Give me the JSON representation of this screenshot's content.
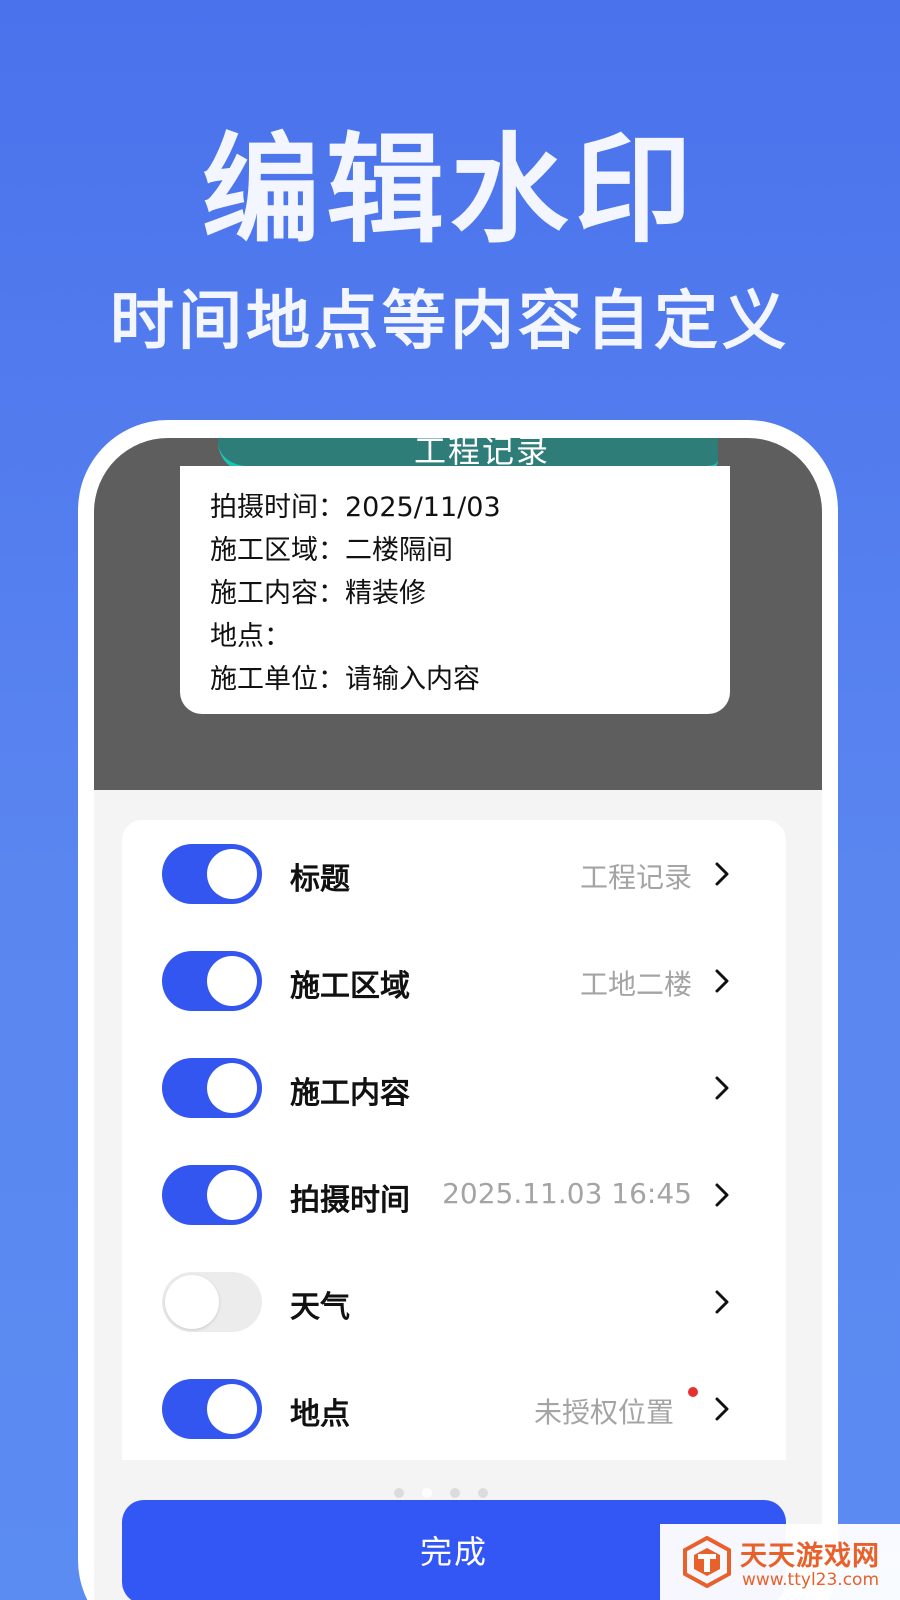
{
  "promo": {
    "title": "编辑水印",
    "subtitle": "时间地点等内容自定义"
  },
  "watermark": {
    "banner_title": "工程记录",
    "lines": [
      {
        "label": "拍摄时间：",
        "value": "2025/11/03"
      },
      {
        "label": "施工区域：",
        "value": "二楼隔间"
      },
      {
        "label": "施工内容：",
        "value": "精装修"
      },
      {
        "label": "地点：",
        "value": ""
      },
      {
        "label": "施工单位：",
        "value": "请输入内容"
      }
    ]
  },
  "settings": {
    "rows": [
      {
        "label": "标题",
        "value": "工程记录",
        "enabled": true,
        "icon": "chevron-right-icon"
      },
      {
        "label": "施工区域",
        "value": "工地二楼",
        "enabled": true,
        "icon": "chevron-right-icon"
      },
      {
        "label": "施工内容",
        "value": "",
        "enabled": true,
        "icon": "chevron-right-icon"
      },
      {
        "label": "拍摄时间",
        "value": "2025.11.03 16:45",
        "enabled": true,
        "icon": "chevron-right-icon"
      },
      {
        "label": "天气",
        "value": "",
        "enabled": false,
        "icon": "chevron-right-icon"
      },
      {
        "label": "地点",
        "value": "未授权位置",
        "enabled": true,
        "has_alert_dot": true,
        "icon": "chevron-right-icon"
      }
    ]
  },
  "pager": {
    "count": 4,
    "active_index": 1
  },
  "done_button": {
    "label": "完成"
  },
  "brand": {
    "name": "天天游戏网",
    "url": "www.ttyl23.com"
  },
  "colors": {
    "background": "#4a72ec",
    "accent": "#3355f0",
    "toggle_off": "#ececec",
    "watermark_banner": "#2f7d78",
    "watermark_banner_edge": "#19c4b0",
    "preview_bg": "#5e5e5e",
    "alert_dot": "#e53030",
    "brand": "#e8602a"
  }
}
